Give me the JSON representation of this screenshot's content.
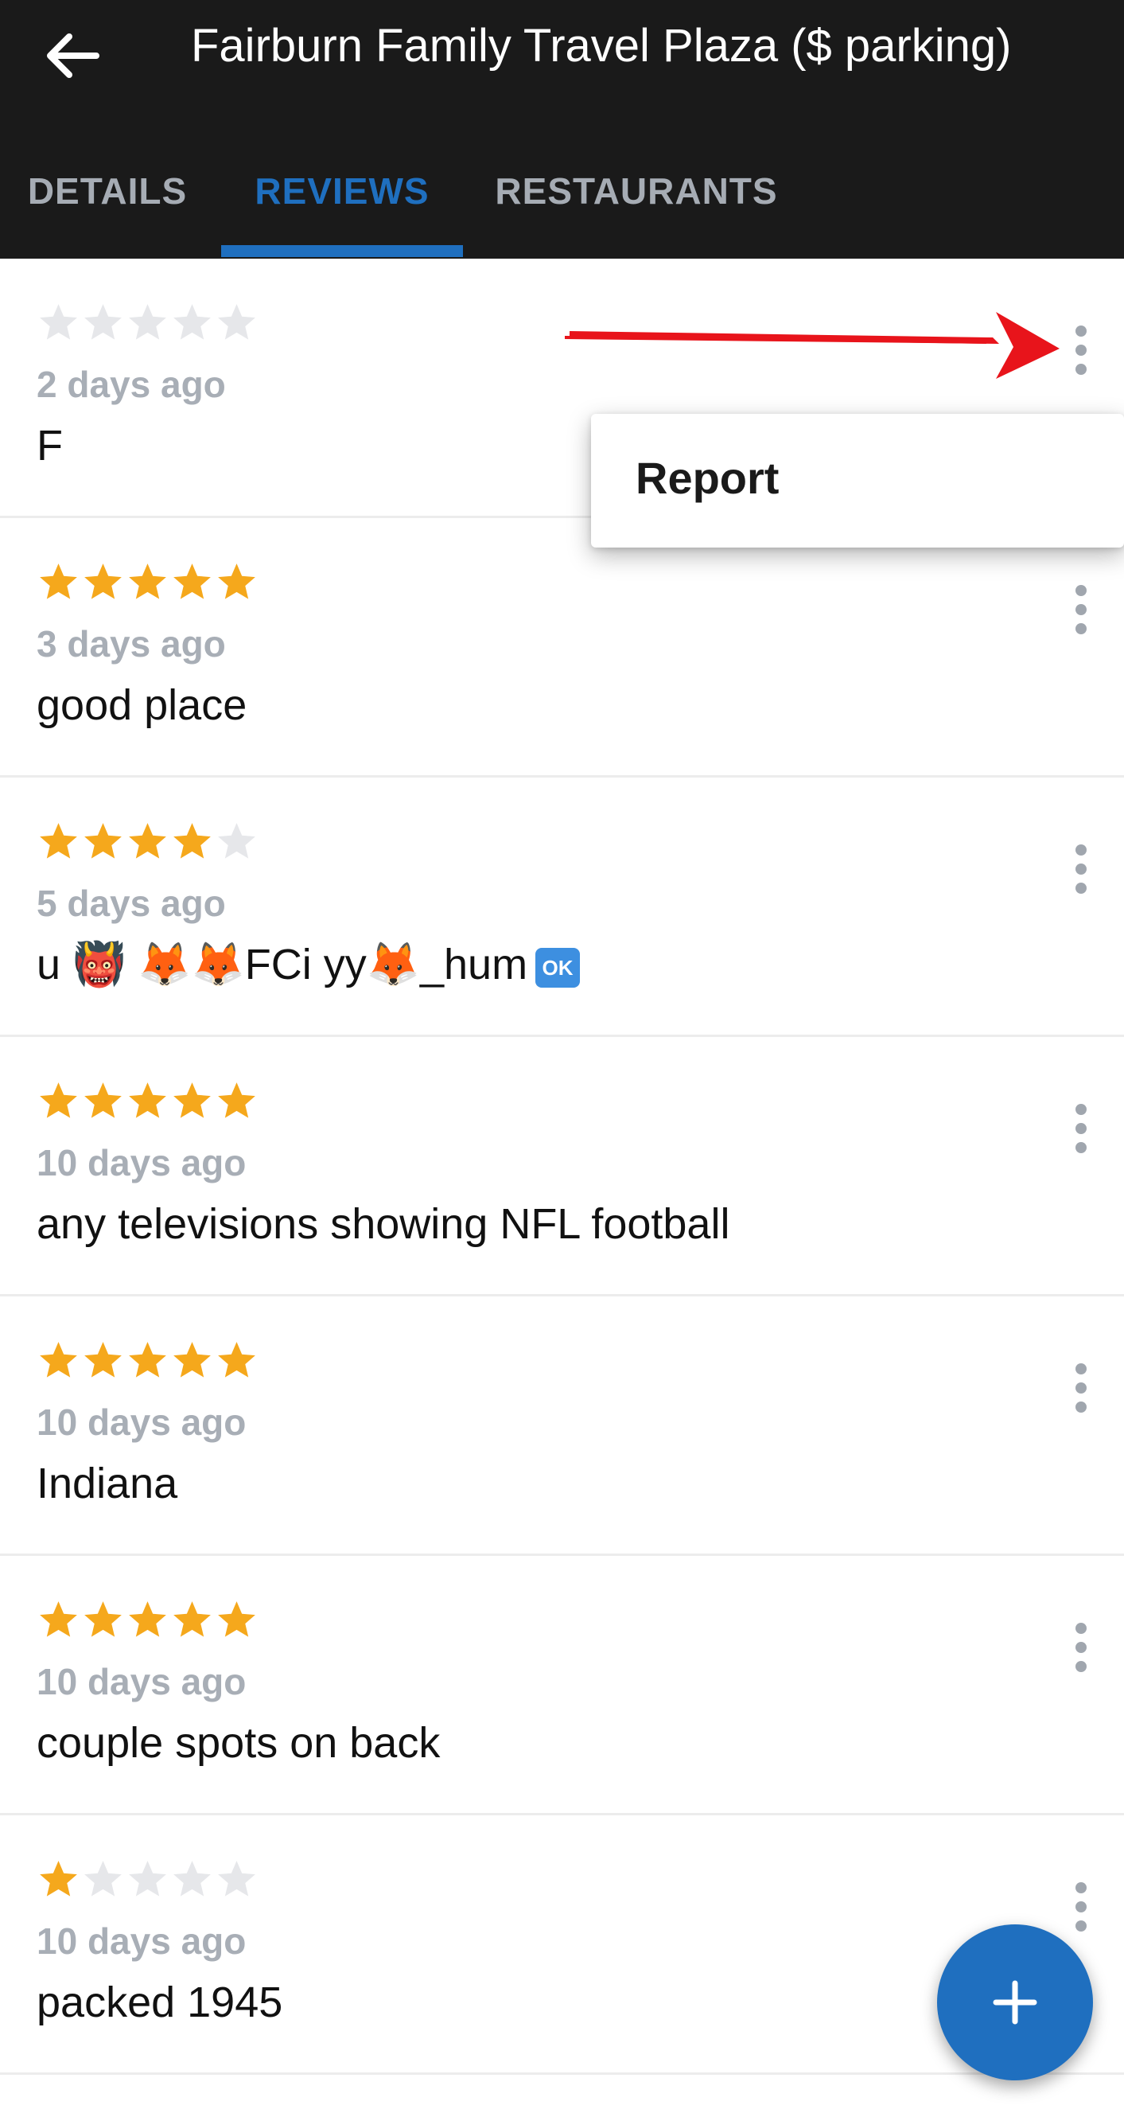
{
  "header": {
    "title": "Fairburn Family Travel Plaza ($ parking)",
    "back_icon": "arrow-left-icon"
  },
  "tabs": [
    {
      "label": "DETAILS",
      "active": false
    },
    {
      "label": "REVIEWS",
      "active": true
    },
    {
      "label": "RESTAURANTS",
      "active": false
    }
  ],
  "colors": {
    "header_bg": "#1a1a1a",
    "accent": "#1f6fbf",
    "star_filled": "#f5a81c",
    "star_empty": "#e6e7ea",
    "annotation_arrow": "#e8141b"
  },
  "reviews": [
    {
      "rating": 0,
      "date": "2 days ago",
      "text": "F"
    },
    {
      "rating": 5,
      "date": "3 days ago",
      "text": "good place"
    },
    {
      "rating": 4,
      "date": "5 days ago",
      "text": "u 👹 🦊🦊FCi yy🦊_hum",
      "badge": "OK"
    },
    {
      "rating": 5,
      "date": "10 days ago",
      "text": "any televisions showing NFL football"
    },
    {
      "rating": 5,
      "date": "10 days ago",
      "text": "Indiana"
    },
    {
      "rating": 5,
      "date": "10 days ago",
      "text": "couple spots on back"
    },
    {
      "rating": 1,
      "date": "10 days ago",
      "text": "packed 1945"
    }
  ],
  "popup_menu": {
    "items": [
      {
        "label": "Report"
      }
    ]
  },
  "fab": {
    "icon": "plus-icon"
  }
}
